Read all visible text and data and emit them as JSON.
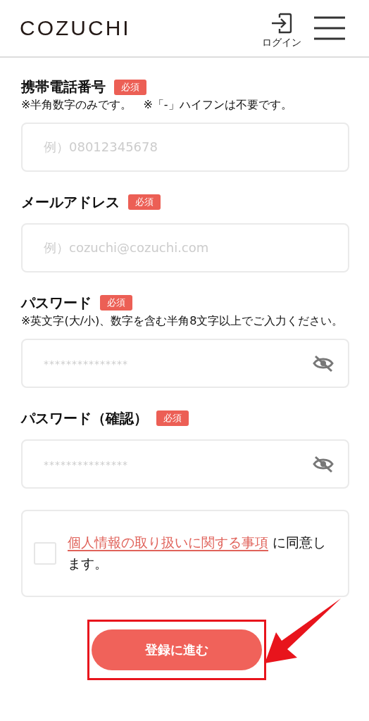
{
  "header": {
    "logo": "COZUCHI",
    "login_label": "ログイン"
  },
  "fields": [
    {
      "kind": "text",
      "label": "携帯電話番号",
      "badge": "必須",
      "note": "※半角数字のみです。　※「-」ハイフンは不要です。",
      "placeholder": "例）08012345678"
    },
    {
      "kind": "text",
      "label": "メールアドレス",
      "badge": "必須",
      "placeholder": "例）cozuchi@cozuchi.com"
    },
    {
      "kind": "password",
      "label": "パスワード",
      "badge": "必須",
      "note": "※英文字(大/小)、数字を含む半角8文字以上でご入力ください。",
      "placeholder": "***************"
    },
    {
      "kind": "password",
      "label": "パスワード（確認）",
      "badge": "必須",
      "placeholder": "***************"
    }
  ],
  "consent": {
    "checked": false,
    "link": "個人情報の取り扱いに関する事項",
    "text": "に同意します。"
  },
  "submit": {
    "label": "登録に進む",
    "highlighted": true
  }
}
